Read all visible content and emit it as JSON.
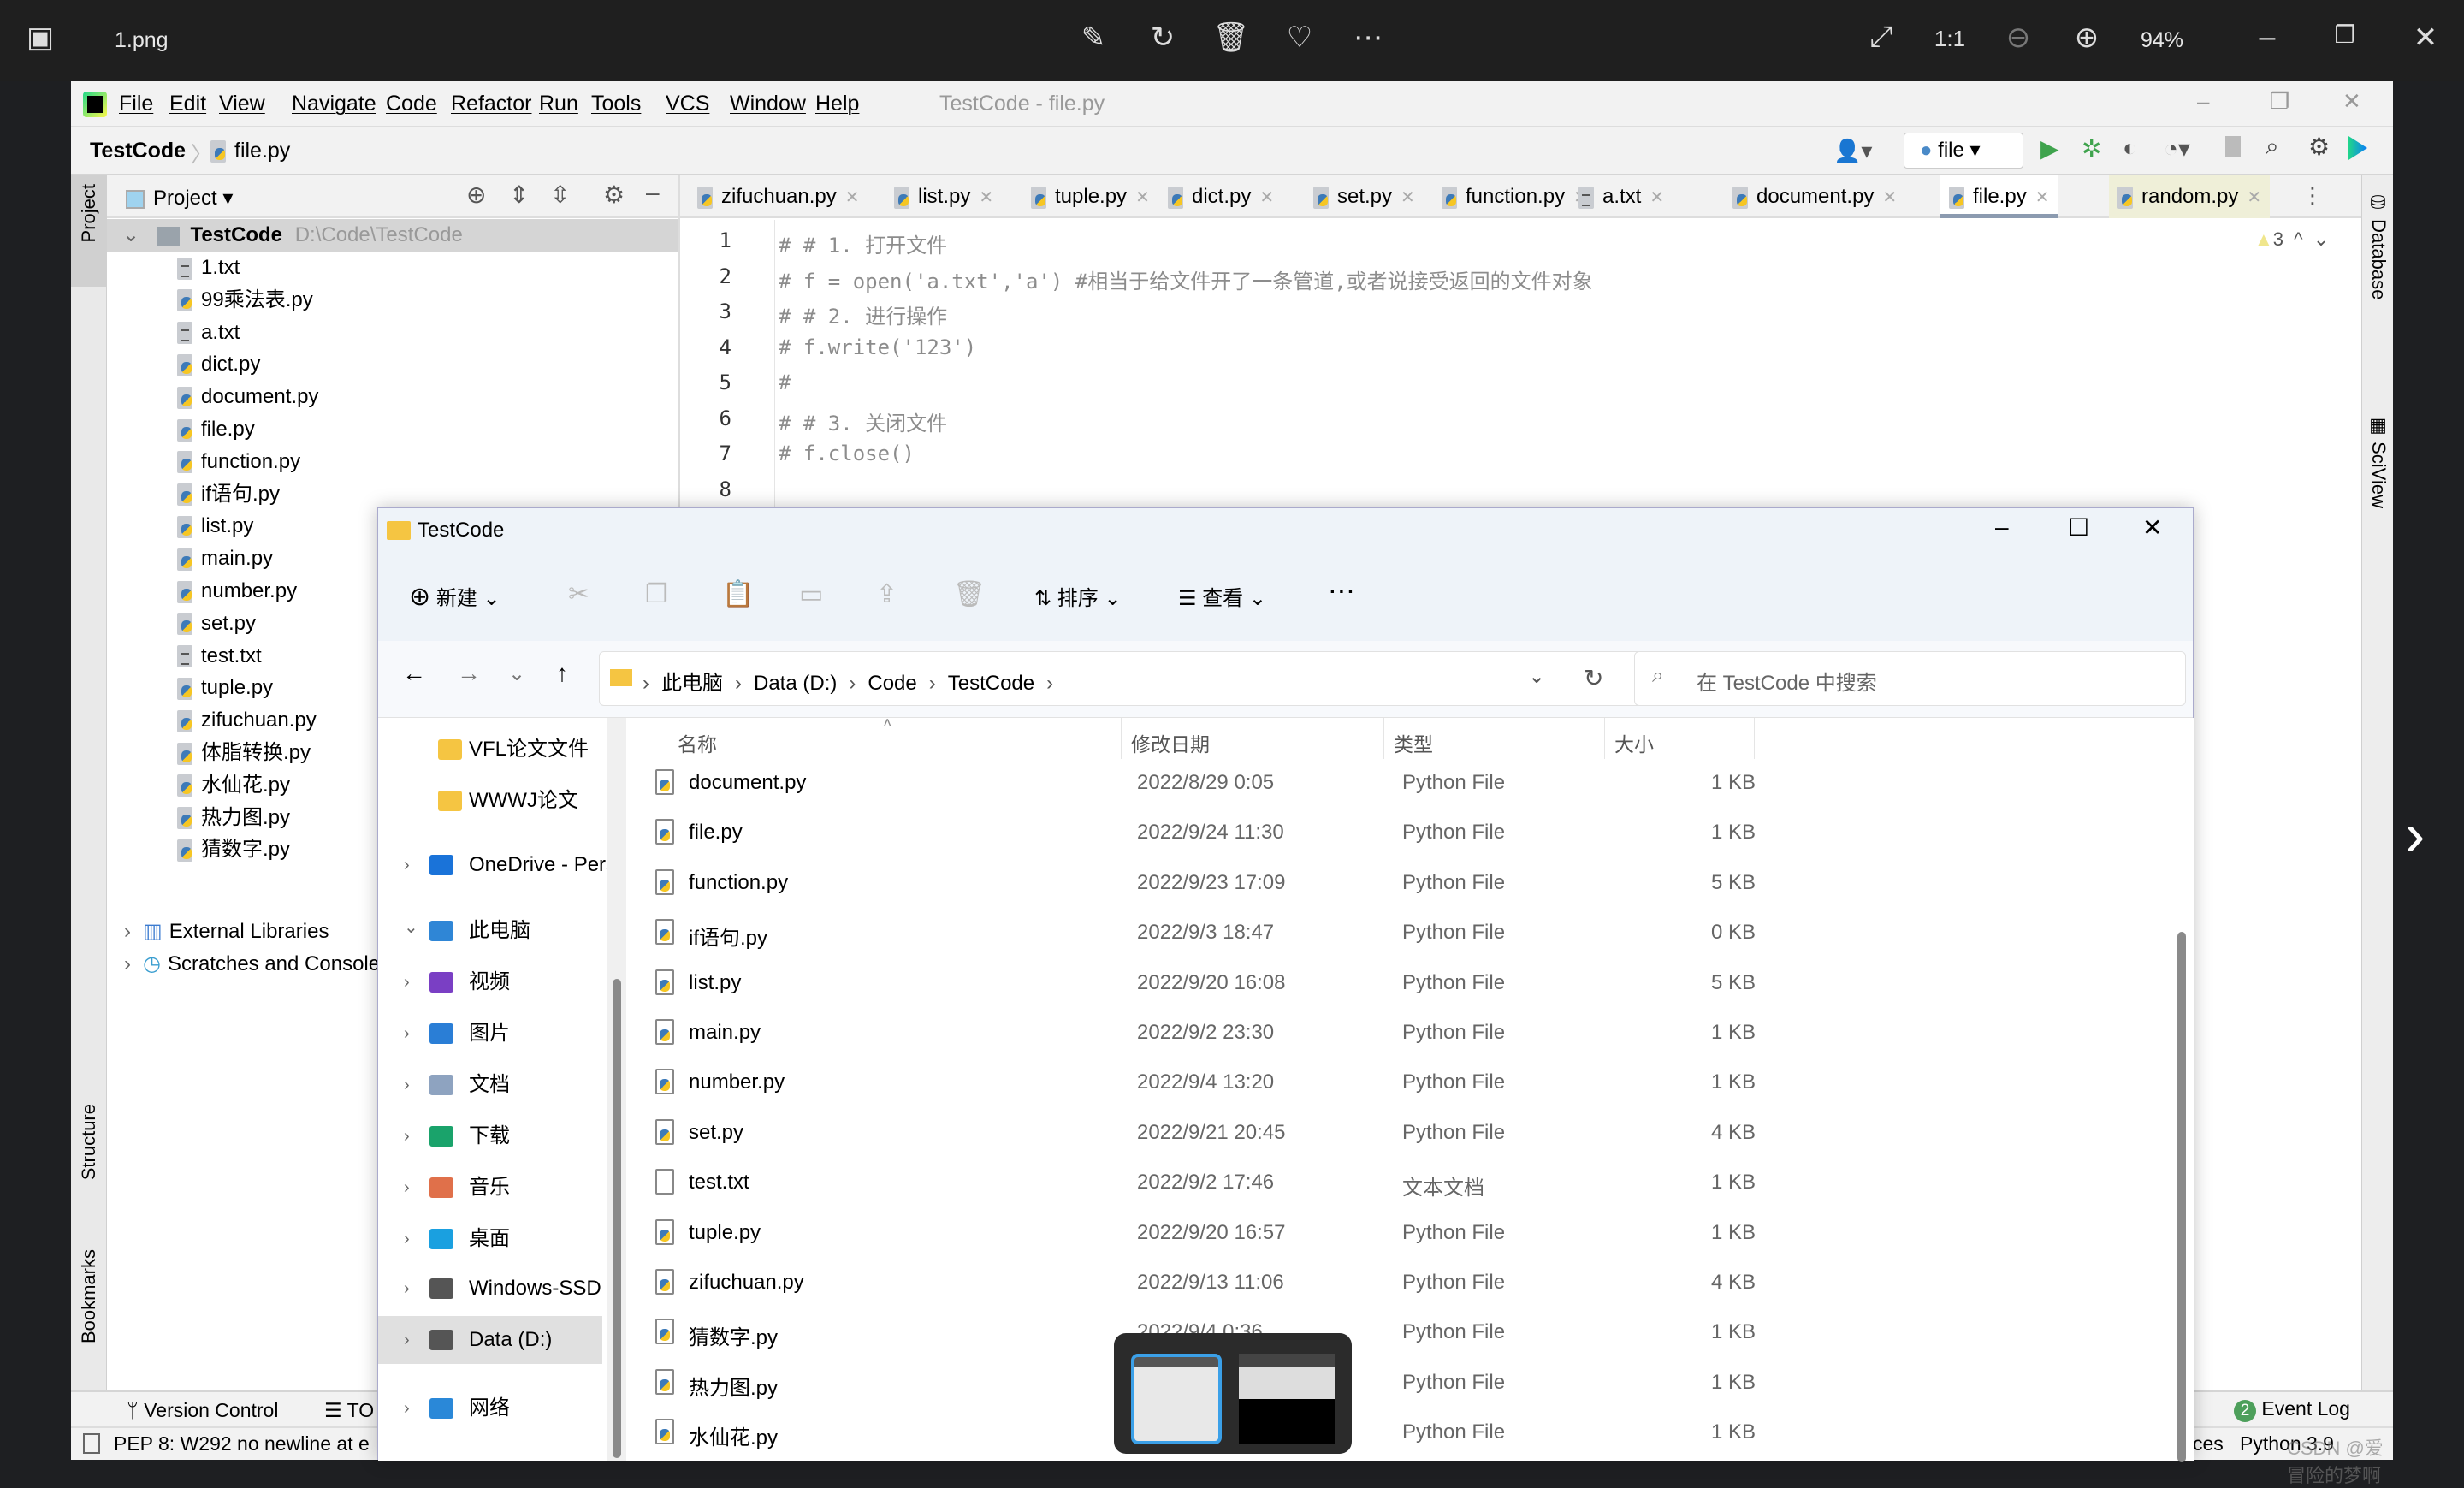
{
  "viewer": {
    "filename": "1.png",
    "zoom": "94%",
    "icons": [
      "edit-icon",
      "rotate-icon",
      "delete-icon",
      "heart-icon",
      "more-icon",
      "fullscreen-icon",
      "actual-size-icon",
      "zoom-out-icon",
      "zoom-in-icon"
    ]
  },
  "ide": {
    "menu": [
      "File",
      "Edit",
      "View",
      "Navigate",
      "Code",
      "Refactor",
      "Run",
      "Tools",
      "VCS",
      "Window",
      "Help"
    ],
    "window_title": "TestCode - file.py",
    "breadcrumb": [
      "TestCode",
      "file.py"
    ],
    "run_config": "file",
    "left_strip": {
      "project": "Project",
      "structure": "Structure",
      "bookmarks": "Bookmarks"
    },
    "right_strip": {
      "database": "Database",
      "sciview": "SciView"
    },
    "project_panel": {
      "title": "Project",
      "root": {
        "name": "TestCode",
        "path": "D:\\Code\\TestCode"
      },
      "files": [
        {
          "name": "1.txt",
          "type": "txt"
        },
        {
          "name": "99乘法表.py",
          "type": "py"
        },
        {
          "name": "a.txt",
          "type": "txt"
        },
        {
          "name": "dict.py",
          "type": "py"
        },
        {
          "name": "document.py",
          "type": "py"
        },
        {
          "name": "file.py",
          "type": "py"
        },
        {
          "name": "function.py",
          "type": "py"
        },
        {
          "name": "if语句.py",
          "type": "py"
        },
        {
          "name": "list.py",
          "type": "py"
        },
        {
          "name": "main.py",
          "type": "py"
        },
        {
          "name": "number.py",
          "type": "py"
        },
        {
          "name": "set.py",
          "type": "py"
        },
        {
          "name": "test.txt",
          "type": "txt"
        },
        {
          "name": "tuple.py",
          "type": "py"
        },
        {
          "name": "zifuchuan.py",
          "type": "py"
        },
        {
          "name": "体脂转换.py",
          "type": "py"
        },
        {
          "name": "水仙花.py",
          "type": "py"
        },
        {
          "name": "热力图.py",
          "type": "py"
        },
        {
          "name": "猜数字.py",
          "type": "py"
        }
      ],
      "extra": [
        "External Libraries",
        "Scratches and Consoles"
      ]
    },
    "tabs": [
      {
        "name": "zifuchuan.py",
        "type": "py"
      },
      {
        "name": "list.py",
        "type": "py"
      },
      {
        "name": "tuple.py",
        "type": "py"
      },
      {
        "name": "dict.py",
        "type": "py"
      },
      {
        "name": "set.py",
        "type": "py"
      },
      {
        "name": "function.py",
        "type": "py"
      },
      {
        "name": "a.txt",
        "type": "txt"
      },
      {
        "name": "document.py",
        "type": "py"
      },
      {
        "name": "file.py",
        "type": "py",
        "active": true
      },
      {
        "name": "random.py",
        "type": "py",
        "highlight": true
      }
    ],
    "warnings_count": "3",
    "code_lines": [
      "# # 1. 打开文件",
      "# f = open('a.txt','a') #相当于给文件开了一条管道,或者说接受返回的文件对象",
      "# # 2. 进行操作",
      "# f.write('123')",
      "#",
      "# # 3. 关闭文件",
      "# f.close()",
      ""
    ],
    "bottom_tools": [
      "Version Control",
      "TO"
    ],
    "event_log": {
      "count": "2",
      "label": "Event Log"
    },
    "status_message": "PEP 8: W292 no newline at e",
    "status_right": [
      "ces",
      "Python 3.9"
    ],
    "watermark": "CSDN @爱冒险的梦啊"
  },
  "explorer": {
    "title": "TestCode",
    "commands": {
      "new": "新建",
      "sort": "排序",
      "view": "查看"
    },
    "address": [
      "此电脑",
      "Data (D:)",
      "Code",
      "TestCode"
    ],
    "search_placeholder": "在 TestCode 中搜索",
    "nav": [
      {
        "label": "VFL论文文件",
        "icon": "folder",
        "color": "#f5c542"
      },
      {
        "label": "WWWJ论文",
        "icon": "folder",
        "color": "#f5c542"
      },
      {
        "label": "OneDrive - Pers",
        "icon": "cloud",
        "color": "#1a73d9",
        "chev": true
      },
      {
        "label": "此电脑",
        "icon": "computer",
        "color": "#2f86d6",
        "chev": true,
        "expanded": true
      },
      {
        "label": "视频",
        "icon": "video",
        "color": "#7a3fc4",
        "chev": true
      },
      {
        "label": "图片",
        "icon": "picture",
        "color": "#2a7ed6",
        "chev": true
      },
      {
        "label": "文档",
        "icon": "document",
        "color": "#8ea3c0",
        "chev": true
      },
      {
        "label": "下载",
        "icon": "download",
        "color": "#1aa36b",
        "chev": true
      },
      {
        "label": "音乐",
        "icon": "music",
        "color": "#e0704a",
        "chev": true
      },
      {
        "label": "桌面",
        "icon": "desktop",
        "color": "#1aa0e0",
        "chev": true
      },
      {
        "label": "Windows-SSD",
        "icon": "drive",
        "color": "#555",
        "chev": true
      },
      {
        "label": "Data (D:)",
        "icon": "drive",
        "color": "#555",
        "chev": true,
        "selected": true
      },
      {
        "label": "网络",
        "icon": "network",
        "color": "#2a88d8",
        "chev": true
      }
    ],
    "columns": [
      "名称",
      "修改日期",
      "类型",
      "大小"
    ],
    "rows": [
      [
        "document.py",
        "2022/8/29 0:05",
        "Python File",
        "1 KB"
      ],
      [
        "file.py",
        "2022/9/24 11:30",
        "Python File",
        "1 KB"
      ],
      [
        "function.py",
        "2022/9/23 17:09",
        "Python File",
        "5 KB"
      ],
      [
        "if语句.py",
        "2022/9/3 18:47",
        "Python File",
        "0 KB"
      ],
      [
        "list.py",
        "2022/9/20 16:08",
        "Python File",
        "5 KB"
      ],
      [
        "main.py",
        "2022/9/2 23:30",
        "Python File",
        "1 KB"
      ],
      [
        "number.py",
        "2022/9/4 13:20",
        "Python File",
        "1 KB"
      ],
      [
        "set.py",
        "2022/9/21 20:45",
        "Python File",
        "4 KB"
      ],
      [
        "test.txt",
        "2022/9/2 17:46",
        "文本文档",
        "1 KB"
      ],
      [
        "tuple.py",
        "2022/9/20 16:57",
        "Python File",
        "1 KB"
      ],
      [
        "zifuchuan.py",
        "2022/9/13 11:06",
        "Python File",
        "4 KB"
      ],
      [
        "猜数字.py",
        "2022/9/4 0:36",
        "Python File",
        "1 KB"
      ],
      [
        "热力图.py",
        "",
        "Python File",
        "1 KB"
      ],
      [
        "水仙花.py",
        "",
        "Python File",
        "1 KB"
      ]
    ]
  }
}
